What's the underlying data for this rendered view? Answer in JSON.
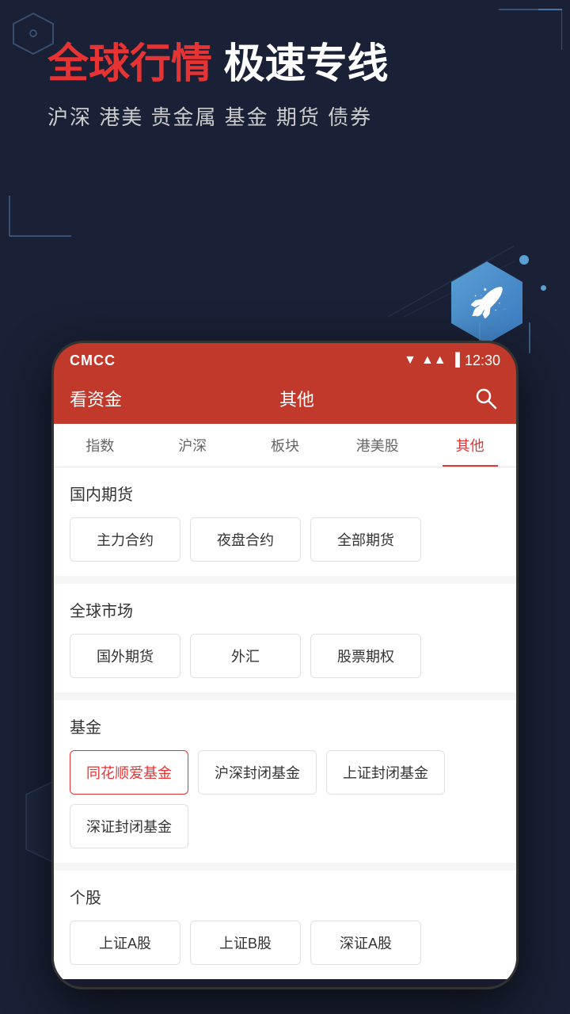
{
  "app": {
    "background_color": "#1a2035"
  },
  "hero": {
    "title_red": "全球行情",
    "title_white": " 极速专线",
    "subtitle": "沪深 港美 贵金属 基金 期货 债券"
  },
  "status_bar": {
    "carrier": "CMCC",
    "time": "12:30"
  },
  "app_header": {
    "left_label": "看资金",
    "center_label": "其他",
    "search_label": "搜索"
  },
  "tabs": [
    {
      "label": "指数",
      "active": false
    },
    {
      "label": "沪深",
      "active": false
    },
    {
      "label": "板块",
      "active": false
    },
    {
      "label": "港美股",
      "active": false
    },
    {
      "label": "其他",
      "active": true
    }
  ],
  "sections": [
    {
      "title": "国内期货",
      "buttons": [
        {
          "label": "主力合约",
          "selected": false
        },
        {
          "label": "夜盘合约",
          "selected": false
        },
        {
          "label": "全部期货",
          "selected": false
        }
      ]
    },
    {
      "title": "全球市场",
      "buttons": [
        {
          "label": "国外期货",
          "selected": false
        },
        {
          "label": "外汇",
          "selected": false
        },
        {
          "label": "股票期权",
          "selected": false
        }
      ]
    },
    {
      "title": "基金",
      "buttons": [
        {
          "label": "同花顺爱基金",
          "selected": true
        },
        {
          "label": "沪深封闭基金",
          "selected": false
        },
        {
          "label": "上证封闭基金",
          "selected": false
        }
      ],
      "extra_buttons": [
        {
          "label": "深证封闭基金",
          "selected": false
        }
      ]
    },
    {
      "title": "个股",
      "buttons": [
        {
          "label": "上证A股",
          "selected": false
        },
        {
          "label": "上证B股",
          "selected": false
        },
        {
          "label": "深证A股",
          "selected": false
        }
      ]
    }
  ]
}
